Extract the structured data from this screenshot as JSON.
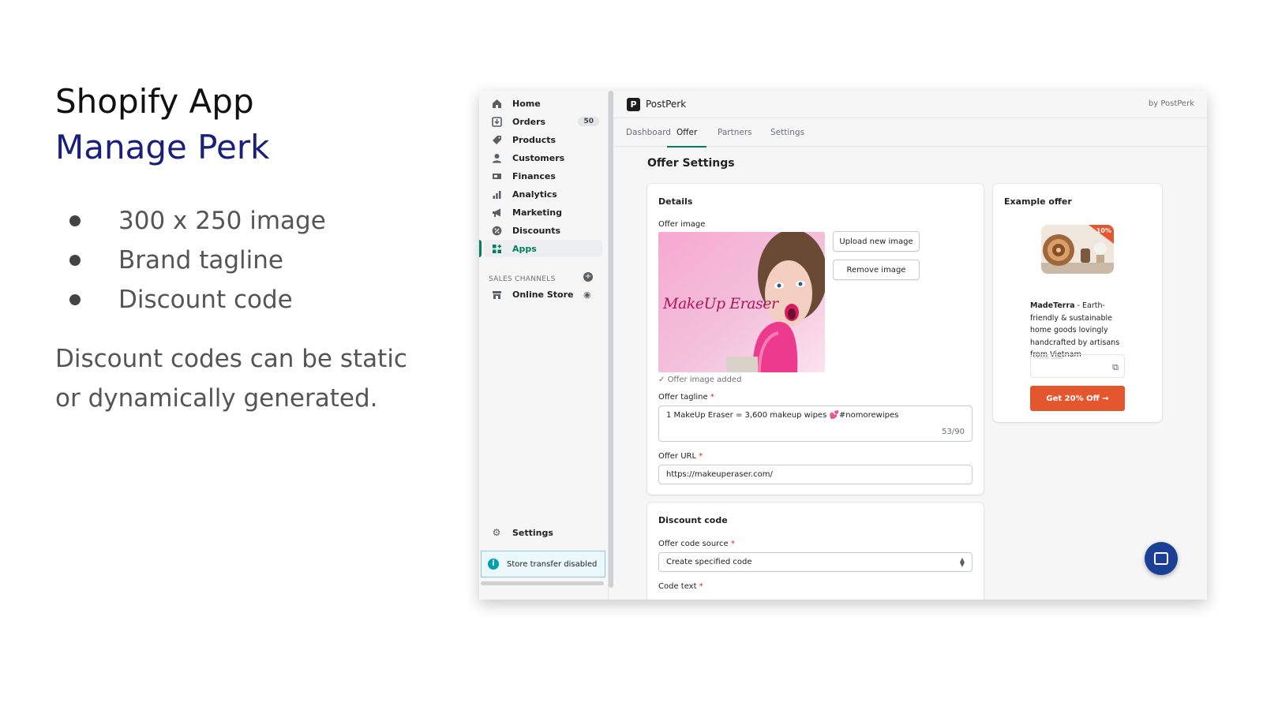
{
  "slide": {
    "title": "Shopify App",
    "subtitle": "Manage Perk",
    "bullets": [
      "300 x 250 image",
      "Brand tagline",
      "Discount code"
    ],
    "note": "Discount codes can be static or dynamically generated."
  },
  "sidebar": {
    "items": [
      {
        "label": "Home",
        "icon": "home-icon"
      },
      {
        "label": "Orders",
        "icon": "orders-icon",
        "badge": "50"
      },
      {
        "label": "Products",
        "icon": "tag-icon"
      },
      {
        "label": "Customers",
        "icon": "person-icon"
      },
      {
        "label": "Finances",
        "icon": "finances-icon"
      },
      {
        "label": "Analytics",
        "icon": "bar-chart-icon"
      },
      {
        "label": "Marketing",
        "icon": "megaphone-icon"
      },
      {
        "label": "Discounts",
        "icon": "discount-icon"
      },
      {
        "label": "Apps",
        "icon": "apps-icon",
        "active": true
      }
    ],
    "sales_channels_label": "SALES CHANNELS",
    "online_store": "Online Store",
    "settings": "Settings",
    "store_transfer": "Store transfer disabled"
  },
  "topbar": {
    "logo_letter": "P",
    "app_name": "PostPerk",
    "by_label": "by PostPerk"
  },
  "tabs": [
    "Dashboard",
    "Offer",
    "Partners",
    "Settings"
  ],
  "active_tab": "Offer",
  "page_title": "Offer Settings",
  "details": {
    "title": "Details",
    "offer_image_label": "Offer image",
    "image_text": "MakeUp Eraser",
    "upload_button": "Upload new image",
    "remove_button": "Remove image",
    "image_added_note": "Offer image added",
    "tagline_label": "Offer tagline",
    "tagline_value": "1 MakeUp Eraser = 3,600 makeup wipes 💕#nomorewipes",
    "tagline_counter": "53/90",
    "url_label": "Offer URL",
    "url_value": "https://makeuperaser.com/"
  },
  "discount": {
    "title": "Discount code",
    "source_label": "Offer code source",
    "source_value": "Create specified code",
    "code_text_label": "Code text"
  },
  "example": {
    "title": "Example offer",
    "badge": "10%",
    "brand": "MadeTerra",
    "description": " - Earth-friendly & sustainable home goods lovingly handcrafted by artisans from Vietnam",
    "promo_label": "Promo Code",
    "cta": "Get 20% Off →"
  },
  "colors": {
    "brand_blue": "#1a1f7a",
    "shopify_green": "#008060",
    "cta_orange": "#e4572e",
    "chat_blue": "#1c3f96"
  }
}
